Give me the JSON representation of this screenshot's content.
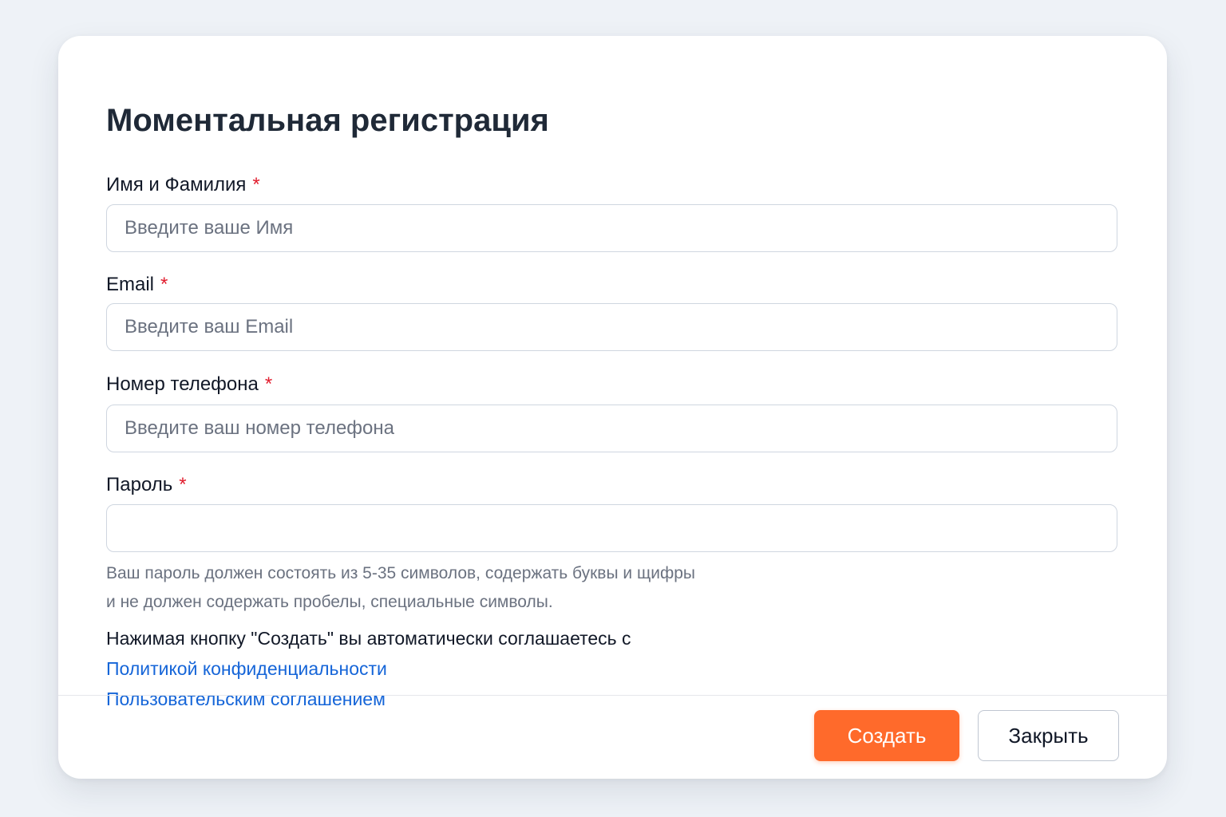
{
  "modal": {
    "title": "Моментальная регистрация"
  },
  "fields": {
    "name": {
      "label": "Имя и Фамилия",
      "required_mark": "*",
      "placeholder": "Введите ваше Имя",
      "value": ""
    },
    "email": {
      "label": "Email",
      "required_mark": "*",
      "placeholder": "Введите ваш Email",
      "value": ""
    },
    "phone": {
      "label": "Номер телефона",
      "required_mark": "*",
      "placeholder": "Введите ваш номер телефона",
      "value": ""
    },
    "password": {
      "label": "Пароль",
      "required_mark": "*",
      "placeholder": "",
      "value": ""
    }
  },
  "password_hint": {
    "line1": "Ваш пароль должен состоять из 5-35 символов, содержать буквы и щифры",
    "line2": "и не должен содержать пробелы, специальные символы."
  },
  "consent": {
    "text": "Нажимая кнопку \"Создать\" вы автоматически соглашаетесь с",
    "privacy_link": "Политикой конфиденциальности",
    "agreement_link": "Пользовательским соглашением"
  },
  "footer": {
    "create_label": "Создать",
    "close_label": "Закрыть"
  },
  "colors": {
    "accent": "#ff6a2b",
    "link": "#1565d8",
    "required": "#e11d2e"
  }
}
